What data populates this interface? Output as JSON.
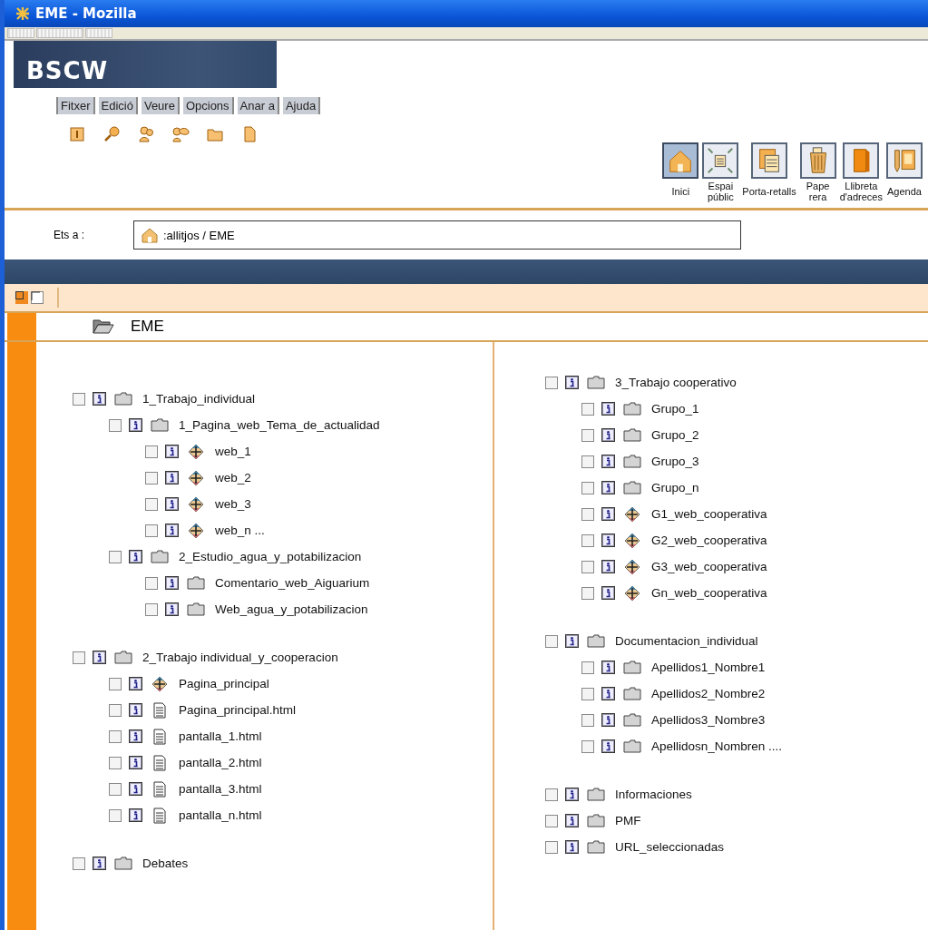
{
  "window": {
    "title": "EME - Mozilla"
  },
  "logo": {
    "text": "BSCW"
  },
  "menu": [
    {
      "label": "Fitxer"
    },
    {
      "label": "Edició"
    },
    {
      "label": "Veure"
    },
    {
      "label": "Opcions"
    },
    {
      "label": "Anar a"
    },
    {
      "label": "Ajuda"
    }
  ],
  "nav_buttons": [
    {
      "label": "Inici",
      "kind": "home",
      "selected": true
    },
    {
      "label": "Espai\npúblic",
      "kind": "public",
      "selected": false
    },
    {
      "label": "Porta-retalls",
      "kind": "clipboard",
      "selected": false
    },
    {
      "label": "Pape\nrera",
      "kind": "trash",
      "selected": false
    },
    {
      "label": "Llibreta\nd'adreces",
      "kind": "book",
      "selected": false
    },
    {
      "label": "Agenda",
      "kind": "agenda",
      "selected": false
    }
  ],
  "location": {
    "label": "Ets a :",
    "path": ":allitjos / EME"
  },
  "folder": {
    "title": "EME"
  },
  "columns": [
    [
      [
        {
          "name": "1_Trabajo_individual",
          "kind": "folder",
          "checked": false,
          "children": [
            {
              "name": "1_Pagina_web_Tema_de_actualidad",
              "kind": "folder",
              "checked": false,
              "children": [
                {
                  "name": "web_1",
                  "kind": "web",
                  "checked": false
                },
                {
                  "name": "web_2",
                  "kind": "web",
                  "checked": false
                },
                {
                  "name": "web_3",
                  "kind": "web",
                  "checked": false
                },
                {
                  "name": "web_n ...",
                  "kind": "web",
                  "checked": false
                }
              ]
            },
            {
              "name": "2_Estudio_agua_y_potabilizacion",
              "kind": "folder",
              "checked": false,
              "children": [
                {
                  "name": "Comentario_web_Aiguarium",
                  "kind": "folder",
                  "checked": false
                },
                {
                  "name": "Web_agua_y_potabilizacion",
                  "kind": "folder",
                  "checked": false
                }
              ]
            }
          ]
        }
      ],
      [
        {
          "name": "2_Trabajo individual_y_cooperacion",
          "kind": "folder",
          "checked": false,
          "children": [
            {
              "name": "Pagina_principal",
              "kind": "web",
              "checked": false
            },
            {
              "name": "Pagina_principal.html",
              "kind": "doc",
              "checked": false
            },
            {
              "name": "pantalla_1.html",
              "kind": "doc",
              "checked": false
            },
            {
              "name": "pantalla_2.html",
              "kind": "doc",
              "checked": false
            },
            {
              "name": "pantalla_3.html",
              "kind": "doc",
              "checked": false
            },
            {
              "name": "pantalla_n.html",
              "kind": "doc",
              "checked": false
            }
          ]
        }
      ],
      [
        {
          "name": "Debates",
          "kind": "folder",
          "checked": false
        }
      ]
    ],
    [
      [
        {
          "name": "3_Trabajo cooperativo",
          "kind": "folder",
          "checked": false,
          "children": [
            {
              "name": "Grupo_1",
              "kind": "folder",
              "checked": false
            },
            {
              "name": "Grupo_2",
              "kind": "folder",
              "checked": false
            },
            {
              "name": "Grupo_3",
              "kind": "folder",
              "checked": false
            },
            {
              "name": "Grupo_n",
              "kind": "folder",
              "checked": false
            },
            {
              "name": "G1_web_cooperativa",
              "kind": "web",
              "checked": false
            },
            {
              "name": "G2_web_cooperativa",
              "kind": "web",
              "checked": false
            },
            {
              "name": "G3_web_cooperativa",
              "kind": "web",
              "checked": false
            },
            {
              "name": "Gn_web_cooperativa",
              "kind": "web",
              "checked": false
            }
          ]
        }
      ],
      [
        {
          "name": "Documentacion_individual",
          "kind": "folder",
          "checked": false,
          "children": [
            {
              "name": "Apellidos1_Nombre1",
              "kind": "folder",
              "checked": false
            },
            {
              "name": "Apellidos2_Nombre2",
              "kind": "folder",
              "checked": false
            },
            {
              "name": "Apellidos3_Nombre3",
              "kind": "folder",
              "checked": false
            },
            {
              "name": "Apellidosn_Nombren ....",
              "kind": "folder",
              "checked": false
            }
          ]
        }
      ],
      [
        {
          "name": "Informaciones",
          "kind": "folder",
          "checked": false
        },
        {
          "name": "PMF",
          "kind": "folder",
          "checked": false
        },
        {
          "name": "URL_seleccionadas",
          "kind": "folder",
          "checked": false
        }
      ]
    ]
  ]
}
